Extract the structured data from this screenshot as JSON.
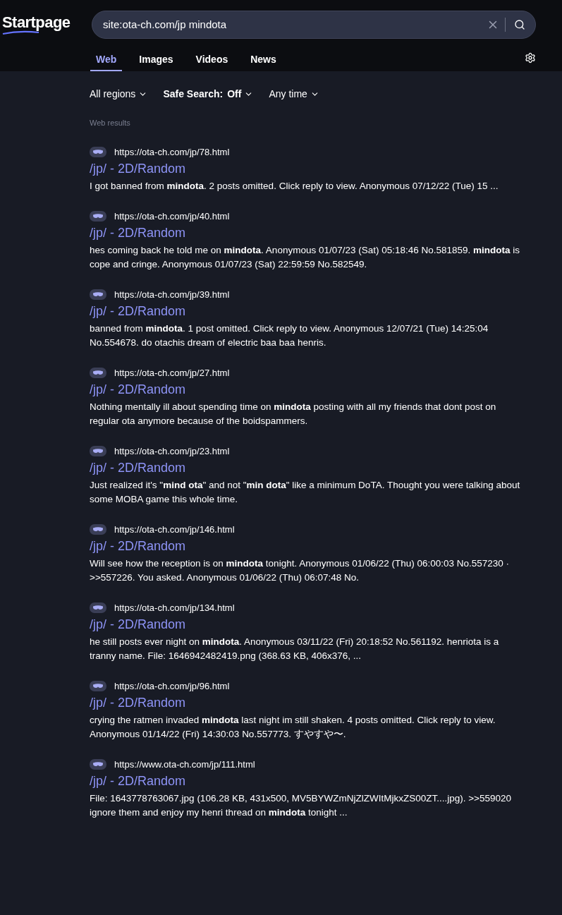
{
  "logo": "Startpage",
  "search": {
    "value": "site:ota-ch.com/jp mindota"
  },
  "tabs": [
    {
      "label": "Web",
      "selected": true
    },
    {
      "label": "Images",
      "selected": false
    },
    {
      "label": "Videos",
      "selected": false
    },
    {
      "label": "News",
      "selected": false
    }
  ],
  "filters": [
    {
      "label": "All regions"
    },
    {
      "label": "Safe Search:",
      "value": "Off"
    },
    {
      "label": "Any time"
    }
  ],
  "section_label": "Web results",
  "results": [
    {
      "url": "https://ota-ch.com/jp/78.html",
      "title": "/jp/ - 2D/Random",
      "snippet": "I got banned from **mindota**. 2 posts omitted. Click reply to view. Anonymous 07/12/22 (Tue) 15 ..."
    },
    {
      "url": "https://ota-ch.com/jp/40.html",
      "title": "/jp/ - 2D/Random",
      "snippet": "hes coming back he told me on **mindota**. Anonymous 01/07/23 (Sat) 05:18:46 No.581859. **mindota** is cope and cringe. Anonymous 01/07/23 (Sat) 22:59:59 No.582549."
    },
    {
      "url": "https://ota-ch.com/jp/39.html",
      "title": "/jp/ - 2D/Random",
      "snippet": "banned from **mindota**. 1 post omitted. Click reply to view. Anonymous 12/07/21 (Tue) 14:25:04 No.554678. do otachis dream of electric baa baa henris."
    },
    {
      "url": "https://ota-ch.com/jp/27.html",
      "title": "/jp/ - 2D/Random",
      "snippet": "Nothing mentally ill about spending time on **mindota** posting with all my friends that dont post on regular ota anymore because of the boidspammers."
    },
    {
      "url": "https://ota-ch.com/jp/23.html",
      "title": "/jp/ - 2D/Random",
      "snippet": "Just realized it's \"**mind ota**\" and not \"**min dota**\" like a minimum DoTA. Thought you were talking about some MOBA game this whole time."
    },
    {
      "url": "https://ota-ch.com/jp/146.html",
      "title": "/jp/ - 2D/Random",
      "snippet": "Will see how the reception is on **mindota** tonight. Anonymous 01/06/22 (Thu) 06:00:03 No.557230 · >>557226. You asked. Anonymous 01/06/22 (Thu) 06:07:48 No."
    },
    {
      "url": "https://ota-ch.com/jp/134.html",
      "title": "/jp/ - 2D/Random",
      "snippet": "he still posts ever night on **mindota**. Anonymous 03/11/22 (Fri) 20:18:52 No.561192. henriota is a tranny name. File: 1646942482419.png (368.63 KB, 406x376, ..."
    },
    {
      "url": "https://ota-ch.com/jp/96.html",
      "title": "/jp/ - 2D/Random",
      "snippet": "crying the ratmen invaded **mindota** last night im still shaken. 4 posts omitted. Click reply to view. Anonymous 01/14/22 (Fri) 14:30:03 No.557773. すやすや〜."
    },
    {
      "url": "https://www.ota-ch.com/jp/111.html",
      "title": "/jp/ - 2D/Random",
      "snippet": "File: 1643778763067.jpg (106.28 KB, 431x500, MV5BYWZmNjZlZWItMjkxZS00ZT....jpg). >>559020 ignore them and enjoy my henri thread on **mindota** tonight ..."
    }
  ]
}
